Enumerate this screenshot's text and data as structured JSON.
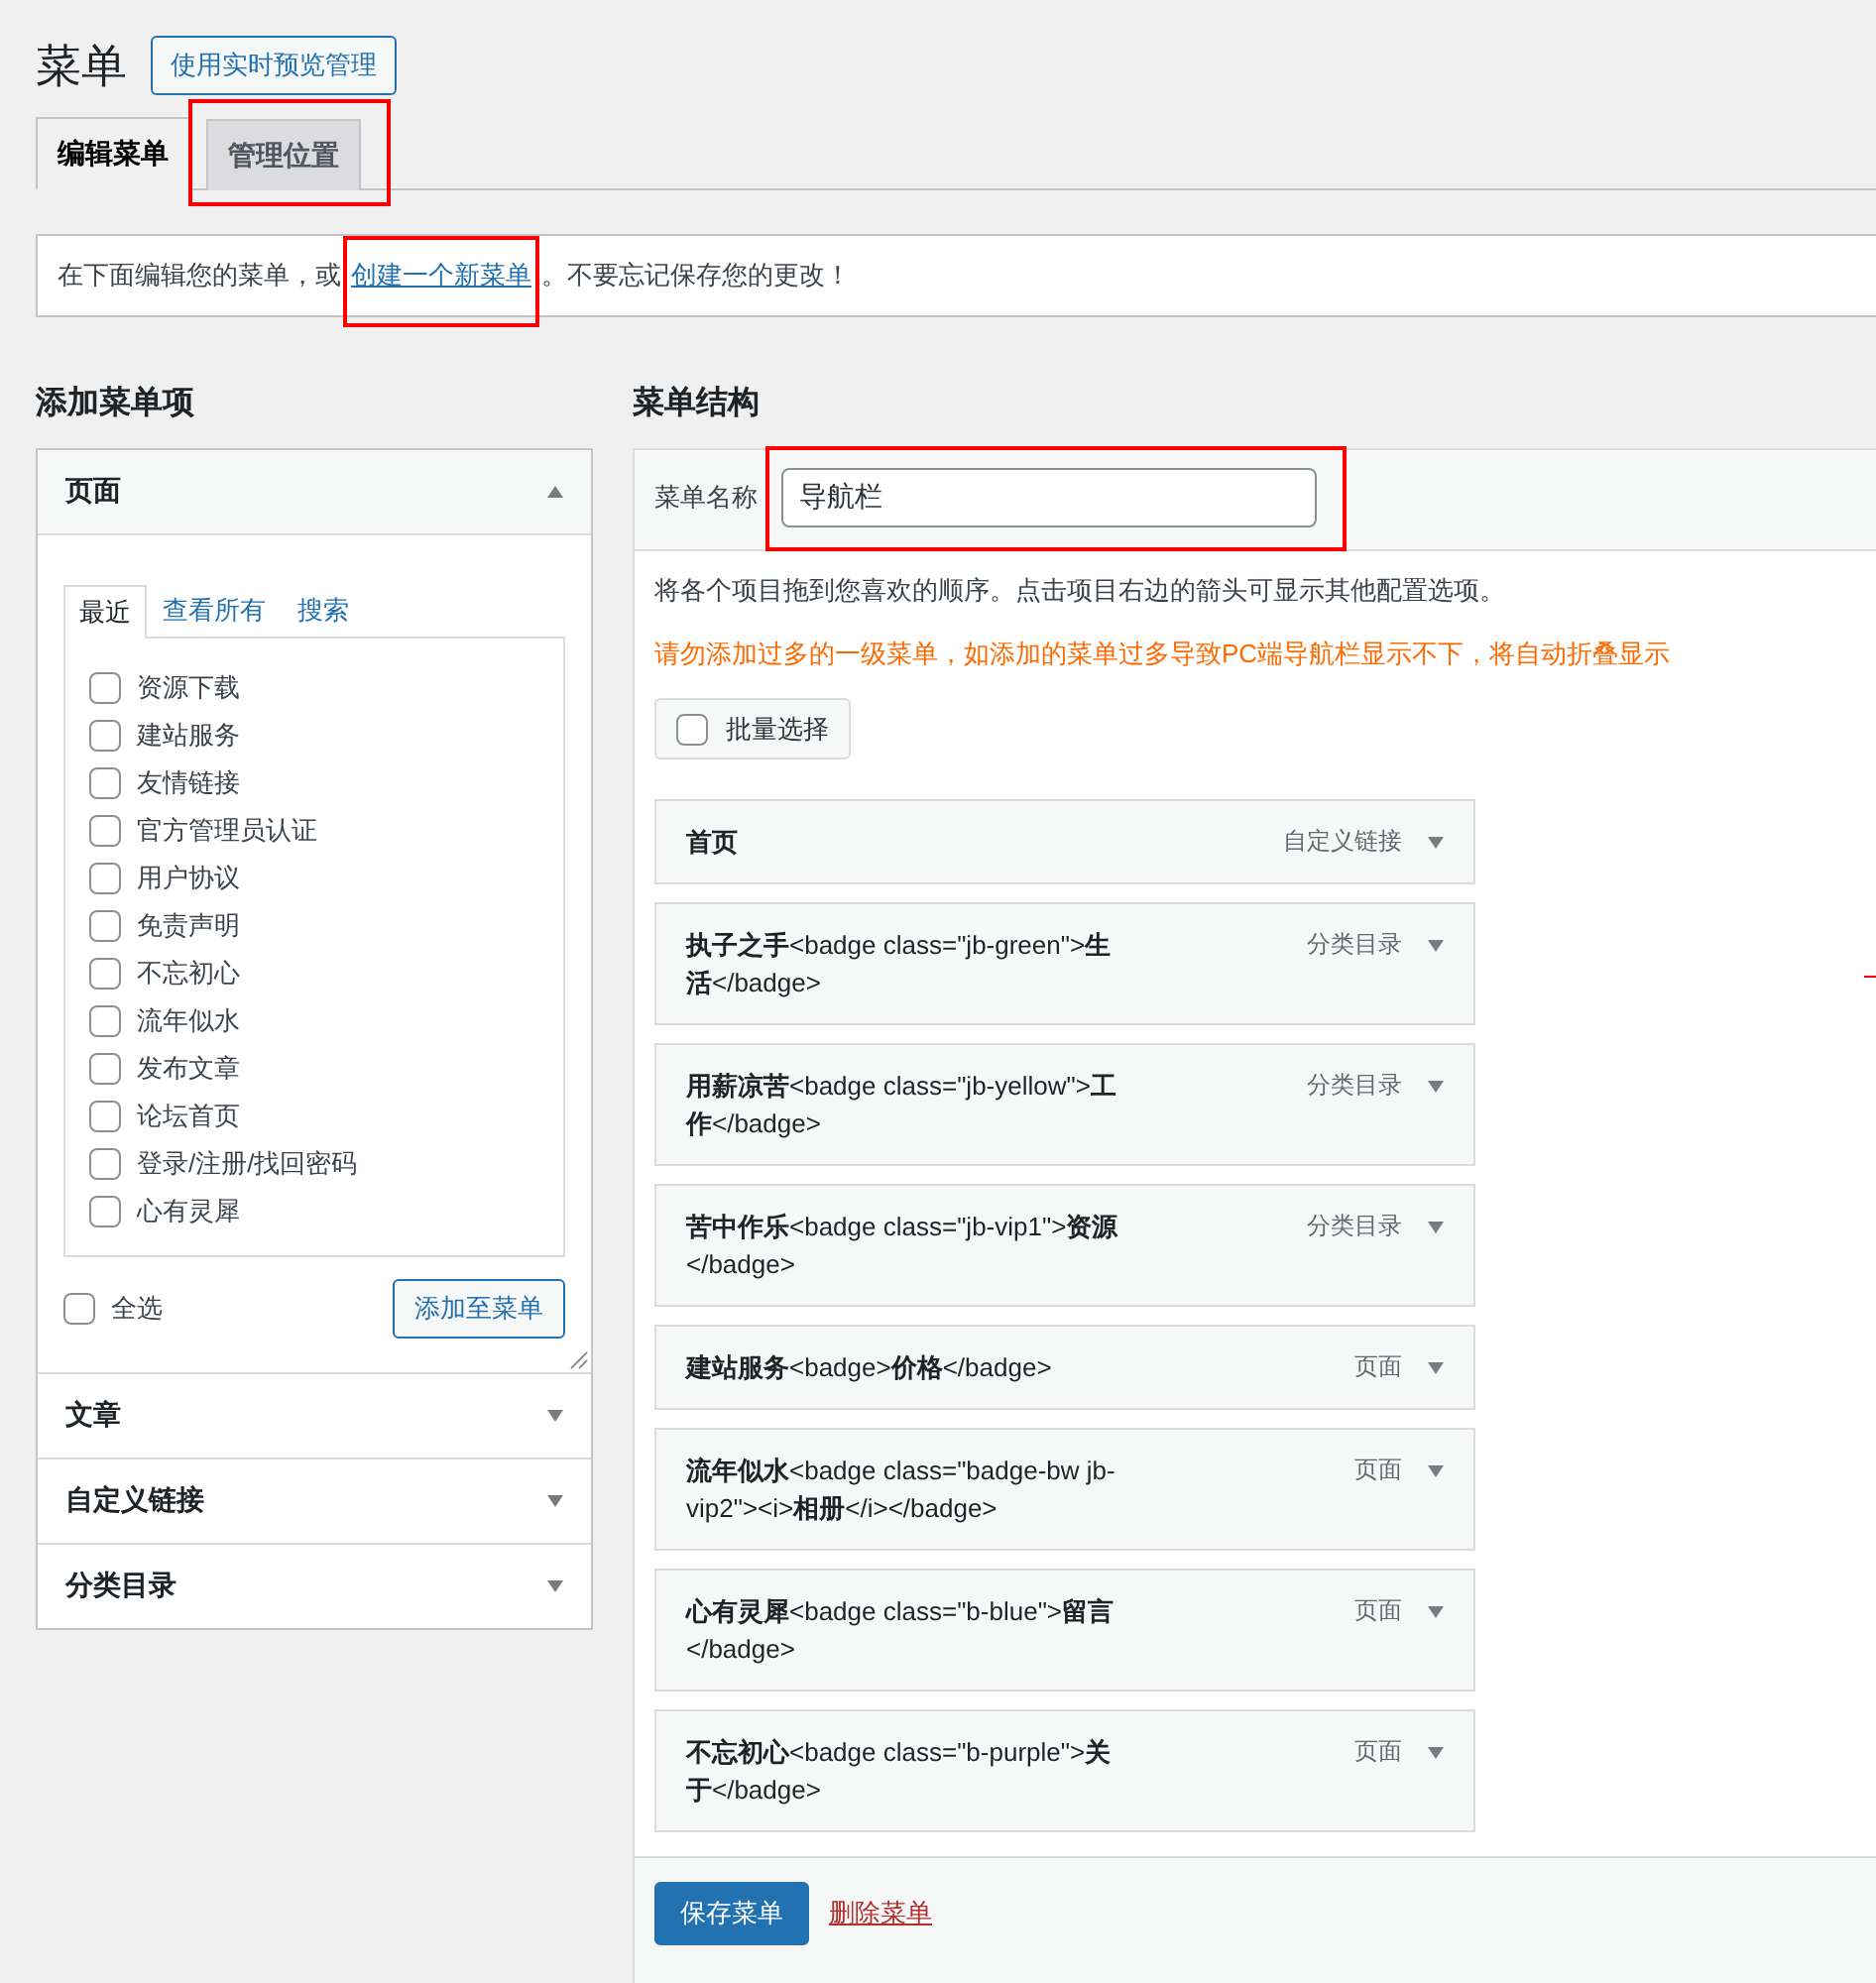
{
  "page_title": "菜单",
  "preview_button": "使用实时预览管理",
  "tabs": [
    {
      "label": "编辑菜单",
      "selected": true,
      "highlighted": false
    },
    {
      "label": "管理位置",
      "selected": false,
      "highlighted": true
    }
  ],
  "notice": {
    "before": "在下面编辑您的菜单，或",
    "link": "创建一个新菜单",
    "link_highlighted": true,
    "after": "。不要忘记保存您的更改！"
  },
  "add_items": {
    "heading": "添加菜单项",
    "sections": [
      {
        "title": "页面",
        "expanded": true,
        "tabs": [
          {
            "label": "最近",
            "selected": true
          },
          {
            "label": "查看所有",
            "selected": false
          },
          {
            "label": "搜索",
            "selected": false
          }
        ],
        "items": [
          {
            "label": "资源下载",
            "checked": false
          },
          {
            "label": "建站服务",
            "checked": false
          },
          {
            "label": "友情链接",
            "checked": false
          },
          {
            "label": "官方管理员认证",
            "checked": false
          },
          {
            "label": "用户协议",
            "checked": false
          },
          {
            "label": "免责声明",
            "checked": false
          },
          {
            "label": "不忘初心",
            "checked": false
          },
          {
            "label": "流年似水",
            "checked": false
          },
          {
            "label": "发布文章",
            "checked": false
          },
          {
            "label": "论坛首页",
            "checked": false
          },
          {
            "label": "登录/注册/找回密码",
            "checked": false
          },
          {
            "label": "心有灵犀",
            "checked": false
          }
        ],
        "select_all": {
          "label": "全选",
          "checked": false
        },
        "add_button": "添加至菜单"
      },
      {
        "title": "文章",
        "expanded": false
      },
      {
        "title": "自定义链接",
        "expanded": false
      },
      {
        "title": "分类目录",
        "expanded": false
      }
    ]
  },
  "structure": {
    "heading": "菜单结构",
    "name_label": "菜单名称",
    "name_value": "导航栏",
    "name_highlighted": true,
    "instructions": "将各个项目拖到您喜欢的顺序。点击项目右边的箭头可显示其他配置选项。",
    "warning": "请勿添加过多的一级菜单，如添加的菜单过多导致PC端导航栏显示不下，将自动折叠显示",
    "bulk_select": {
      "label": "批量选择",
      "checked": false
    },
    "items": [
      {
        "title": "**首页**",
        "type": "自定义链接"
      },
      {
        "title": "**执子之手**<badge class=\"jb-green\">**生活**</badge>",
        "type": "分类目录"
      },
      {
        "title": "**用薪凉苦**<badge class=\"jb-yellow\">**工作**</badge>",
        "type": "分类目录"
      },
      {
        "title": "**苦中作乐**<badge class=\"jb-vip1\">**资源**</badge>",
        "type": "分类目录"
      },
      {
        "title": "**建站服务**<badge>**价格**</badge>",
        "type": "页面"
      },
      {
        "title": "**流年似水**<badge class=\"badge-bw jb-vip2\"><i>**相册**</i></badge>",
        "type": "页面"
      },
      {
        "title": "**心有灵犀**<badge class=\"b-blue\">**留言**</badge>",
        "type": "页面"
      },
      {
        "title": "**不忘初心**<badge class=\"b-purple\">**关于**</badge>",
        "type": "页面"
      }
    ],
    "save_button": "保存菜单",
    "delete_link": "删除菜单"
  }
}
